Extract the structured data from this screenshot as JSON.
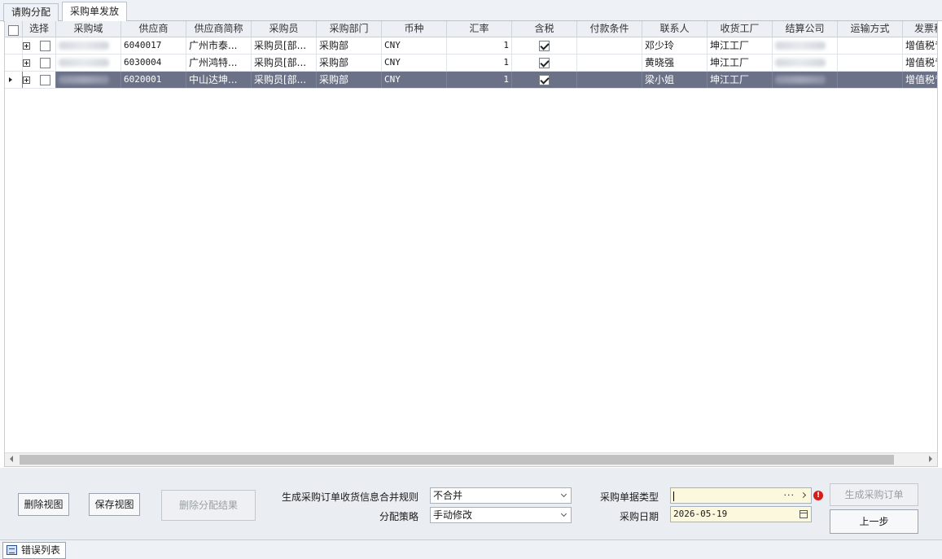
{
  "tabs": [
    {
      "label": "请购分配",
      "active": false
    },
    {
      "label": "采购单发放",
      "active": true
    }
  ],
  "grid": {
    "columns": [
      "选择",
      "采购域",
      "供应商",
      "供应商简称",
      "采购员",
      "采购部门",
      "币种",
      "汇率",
      "含税",
      "付款条件",
      "联系人",
      "收货工厂",
      "结算公司",
      "运输方式",
      "发票税"
    ],
    "rows": [
      {
        "domain": "████",
        "supplier": "6040017",
        "short_name": "广州市泰...",
        "buyer": "采购员[部...",
        "dept": "采购部",
        "currency": "CNY",
        "rate": "1",
        "tax_incl": true,
        "payment": "",
        "contact": "邓少玲",
        "plant": "坤江工厂",
        "settle": "████",
        "transport": "",
        "invoice": "增值税专",
        "selected": false
      },
      {
        "domain": "████",
        "supplier": "6030004",
        "short_name": "广州鸿特...",
        "buyer": "采购员[部...",
        "dept": "采购部",
        "currency": "CNY",
        "rate": "1",
        "tax_incl": true,
        "payment": "",
        "contact": "黄晓强",
        "plant": "坤江工厂",
        "settle": "████",
        "transport": "",
        "invoice": "增值税专",
        "selected": false
      },
      {
        "domain": "████",
        "supplier": "6020001",
        "short_name": "中山达坤...",
        "buyer": "采购员[部...",
        "dept": "采购部",
        "currency": "CNY",
        "rate": "1",
        "tax_incl": true,
        "payment": "",
        "contact": "梁小姐",
        "plant": "坤江工厂",
        "settle": "████",
        "transport": "",
        "invoice": "增值税专",
        "selected": true
      }
    ]
  },
  "panel": {
    "delete_view": "删除视图",
    "save_view": "保存视图",
    "delete_alloc": "删除分配结果",
    "merge_rule_label": "生成采购订单收货信息合并规则",
    "merge_rule_value": "不合并",
    "strategy_label": "分配策略",
    "strategy_value": "手动修改",
    "doc_type_label": "采购单据类型",
    "doc_type_value": "",
    "doc_type_dots": "···",
    "error_mark": "!",
    "date_label": "采购日期",
    "date_value": "2026-05-19",
    "generate": "生成采购订单",
    "prev": "上一步"
  },
  "status": {
    "error_list": "错误列表"
  }
}
